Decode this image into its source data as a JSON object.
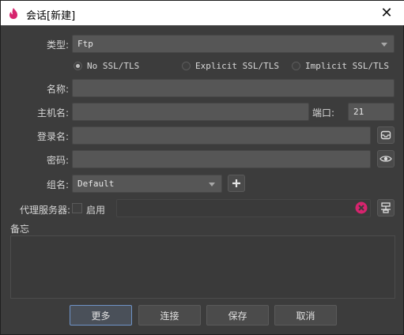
{
  "window": {
    "title": "会话[新建]",
    "close_glyph": "✕"
  },
  "form": {
    "type_label": "类型:",
    "type_value": "Ftp",
    "ssl_options": [
      {
        "label": "No SSL/TLS",
        "selected": true
      },
      {
        "label": "Explicit SSL/TLS",
        "selected": false
      },
      {
        "label": "Implicit SSL/TLS",
        "selected": false
      }
    ],
    "name_label": "名称:",
    "name_value": "",
    "host_label": "主机名:",
    "host_value": "",
    "port_label": "端口:",
    "port_value": "21",
    "login_label": "登录名:",
    "login_value": "",
    "password_label": "密码:",
    "password_value": "",
    "group_label": "组名:",
    "group_value": "Default",
    "proxy_label": "代理服务器:",
    "proxy_enable_label": "启用",
    "proxy_enabled": false,
    "proxy_value": "",
    "memo_label": "备忘",
    "memo_value": ""
  },
  "buttons": {
    "more": "更多",
    "connect": "连接",
    "save": "保存",
    "cancel": "取消"
  },
  "colors": {
    "accent_pink": "#d6246e",
    "focus_blue": "#6f93c7",
    "background": "#3c3c3c"
  },
  "icons": [
    "app-logo-icon",
    "close-icon",
    "chevron-down-icon",
    "key-pair-icon",
    "eye-icon",
    "plus-icon",
    "clear-icon",
    "proxy-settings-icon"
  ]
}
